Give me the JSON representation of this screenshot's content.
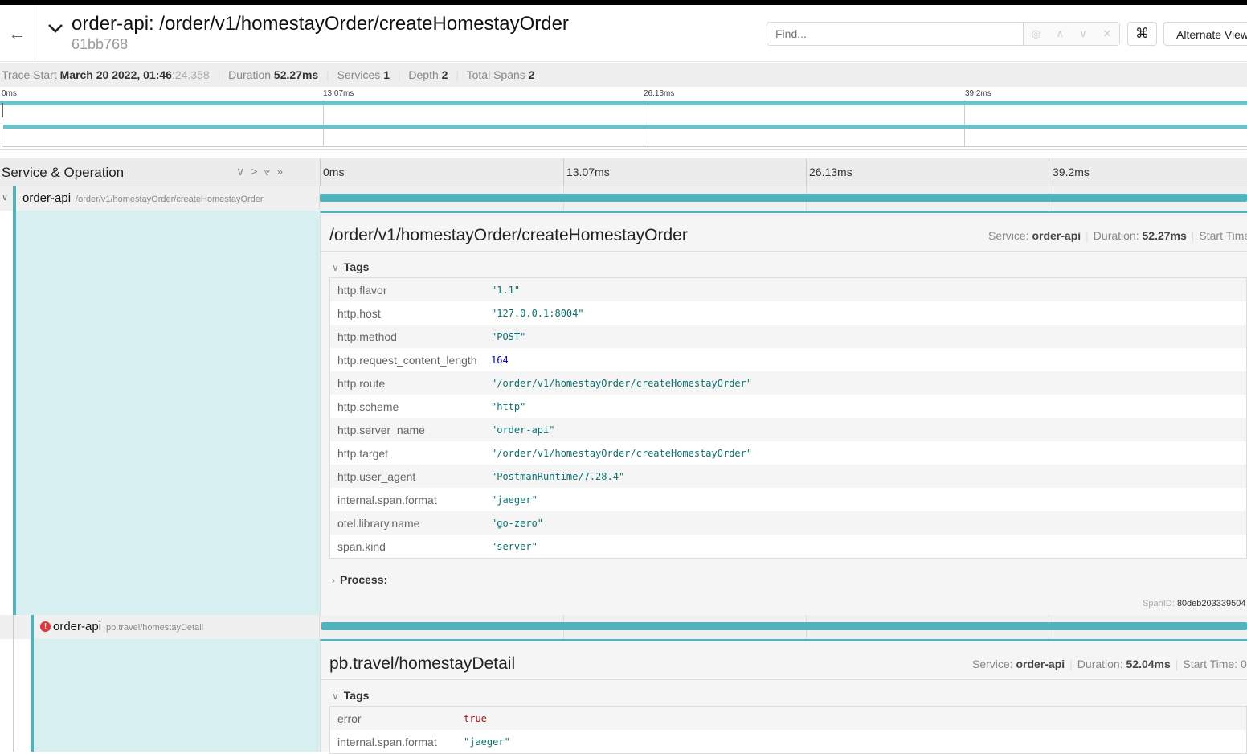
{
  "header": {
    "title": "order-api: /order/v1/homestayOrder/createHomestayOrder",
    "trace_id": "61bb768",
    "find_placeholder": "Find...",
    "cmd_label": "⌘",
    "alternate_view": "Alternate View"
  },
  "meta": {
    "trace_start_label": "Trace Start",
    "trace_start": "March 20 2022, 01:46",
    "trace_start_ms": ":24.358",
    "duration_label": "Duration",
    "duration": "52.27ms",
    "services_label": "Services",
    "services": "1",
    "depth_label": "Depth",
    "depth": "2",
    "total_spans_label": "Total Spans",
    "total_spans": "2"
  },
  "ticks": [
    "0ms",
    "13.07ms",
    "26.13ms",
    "39.2ms"
  ],
  "columns": {
    "service_operation": "Service & Operation"
  },
  "spans": [
    {
      "service": "order-api",
      "operation": "/order/v1/homestayOrder/createHomestayOrder",
      "error": false,
      "detail": {
        "title": "/order/v1/homestayOrder/createHomestayOrder",
        "service_label": "Service:",
        "service": "order-api",
        "duration_label": "Duration:",
        "duration": "52.27ms",
        "start_label": "Start Time",
        "tags_label": "Tags",
        "process_label": "Process:",
        "spanid_label": "SpanID:",
        "spanid": "80deb203339504",
        "tags": [
          {
            "k": "http.flavor",
            "v": "\"1.1\"",
            "t": "str"
          },
          {
            "k": "http.host",
            "v": "\"127.0.0.1:8004\"",
            "t": "str"
          },
          {
            "k": "http.method",
            "v": "\"POST\"",
            "t": "str"
          },
          {
            "k": "http.request_content_length",
            "v": "164",
            "t": "num"
          },
          {
            "k": "http.route",
            "v": "\"/order/v1/homestayOrder/createHomestayOrder\"",
            "t": "str"
          },
          {
            "k": "http.scheme",
            "v": "\"http\"",
            "t": "str"
          },
          {
            "k": "http.server_name",
            "v": "\"order-api\"",
            "t": "str"
          },
          {
            "k": "http.target",
            "v": "\"/order/v1/homestayOrder/createHomestayOrder\"",
            "t": "str"
          },
          {
            "k": "http.user_agent",
            "v": "\"PostmanRuntime/7.28.4\"",
            "t": "str"
          },
          {
            "k": "internal.span.format",
            "v": "\"jaeger\"",
            "t": "str"
          },
          {
            "k": "otel.library.name",
            "v": "\"go-zero\"",
            "t": "str"
          },
          {
            "k": "span.kind",
            "v": "\"server\"",
            "t": "str"
          }
        ]
      }
    },
    {
      "service": "order-api",
      "operation": "pb.travel/homestayDetail",
      "error": true,
      "detail": {
        "title": "pb.travel/homestayDetail",
        "service_label": "Service:",
        "service": "order-api",
        "duration_label": "Duration:",
        "duration": "52.04ms",
        "start_label": "Start Time: 0",
        "tags_label": "Tags",
        "tags": [
          {
            "k": "error",
            "v": "true",
            "t": "bool"
          },
          {
            "k": "internal.span.format",
            "v": "\"jaeger\"",
            "t": "str"
          }
        ]
      }
    }
  ],
  "colors": {
    "span_bar": "#4fb3bb",
    "error": "#d9363e",
    "detail_bg": "#d8eff2"
  }
}
